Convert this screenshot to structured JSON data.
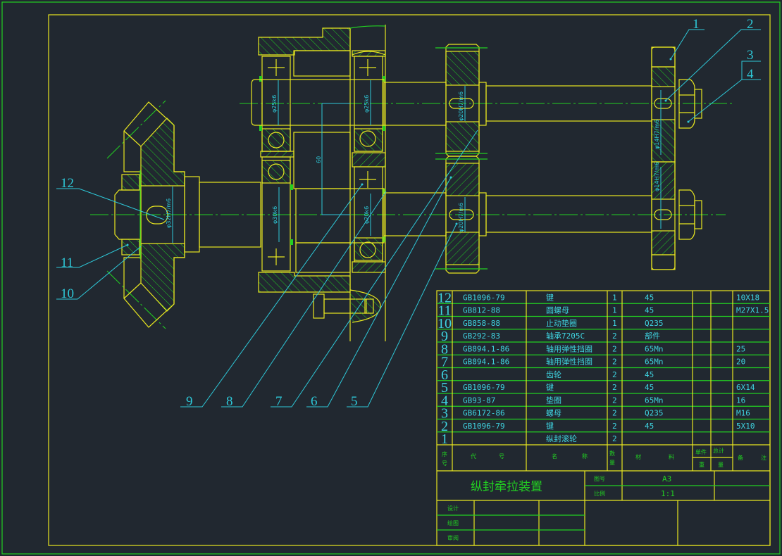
{
  "colors": {
    "background": "#212830",
    "outline": "#e8e620",
    "hatch_centerline": "#22d022",
    "dimension_leader": "#2ec8d8"
  },
  "parts_table": {
    "headers": {
      "seq": [
        "序",
        "号"
      ],
      "code": [
        "代",
        "号"
      ],
      "name": [
        "名",
        "称"
      ],
      "qty": [
        "数",
        "量"
      ],
      "material": [
        "材",
        "料"
      ],
      "unit": "单件",
      "total": "总计",
      "weight": [
        "重",
        "量"
      ],
      "remark": [
        "备",
        "注"
      ]
    },
    "rows": [
      {
        "no": "12",
        "code": "GB1096-79",
        "name": "键",
        "qty": "1",
        "material": "45",
        "remark": "10X18"
      },
      {
        "no": "11",
        "code": "GB812-88",
        "name": "圆螺母",
        "qty": "1",
        "material": "45",
        "remark": "M27X1.5"
      },
      {
        "no": "10",
        "code": "GB858-88",
        "name": "止动垫圈",
        "qty": "1",
        "material": "Q235",
        "remark": ""
      },
      {
        "no": "9",
        "code": "GB292-83",
        "name": "轴承7205C",
        "qty": "2",
        "material": "部件",
        "remark": ""
      },
      {
        "no": "8",
        "code": "GB894.1-86",
        "name": "轴用弹性挡圈",
        "qty": "2",
        "material": "65Mn",
        "remark": "25"
      },
      {
        "no": "7",
        "code": "GB894.1-86",
        "name": "轴用弹性挡圈",
        "qty": "2",
        "material": "65Mn",
        "remark": "20"
      },
      {
        "no": "6",
        "code": "",
        "name": "齿轮",
        "qty": "2",
        "material": "45",
        "remark": ""
      },
      {
        "no": "5",
        "code": "GB1096-79",
        "name": "键",
        "qty": "2",
        "material": "45",
        "remark": "6X14"
      },
      {
        "no": "4",
        "code": "GB93-87",
        "name": "垫圈",
        "qty": "2",
        "material": "65Mn",
        "remark": "16"
      },
      {
        "no": "3",
        "code": "GB6172-86",
        "name": "螺母",
        "qty": "2",
        "material": "Q235",
        "remark": "M16"
      },
      {
        "no": "2",
        "code": "GB1096-79",
        "name": "键",
        "qty": "2",
        "material": "45",
        "remark": "5X10"
      },
      {
        "no": "1",
        "code": "",
        "name": "纵封滚轮",
        "qty": "2",
        "material": "",
        "remark": ""
      }
    ]
  },
  "title_block": {
    "title": "纵封牵拉装置",
    "drawing_no_label": "图号",
    "drawing_no": "A3",
    "scale_label": "比例",
    "scale": "1:1",
    "design_label": "设计",
    "drafting_label": "绘图",
    "review_label": "审阅"
  },
  "balloons": [
    "1",
    "2",
    "3",
    "4",
    "5",
    "6",
    "7",
    "8",
    "9",
    "10",
    "11",
    "12"
  ],
  "dimensions": {
    "d25k6": "φ25k6",
    "d30k6": "φ30k6",
    "d20k6": "φ20k6",
    "center_distance": "60",
    "d20H7m6": "φ20H7/m6",
    "d32H7m6": "φ32H7/m6",
    "d14H7m6": "φ14H7/m6"
  }
}
